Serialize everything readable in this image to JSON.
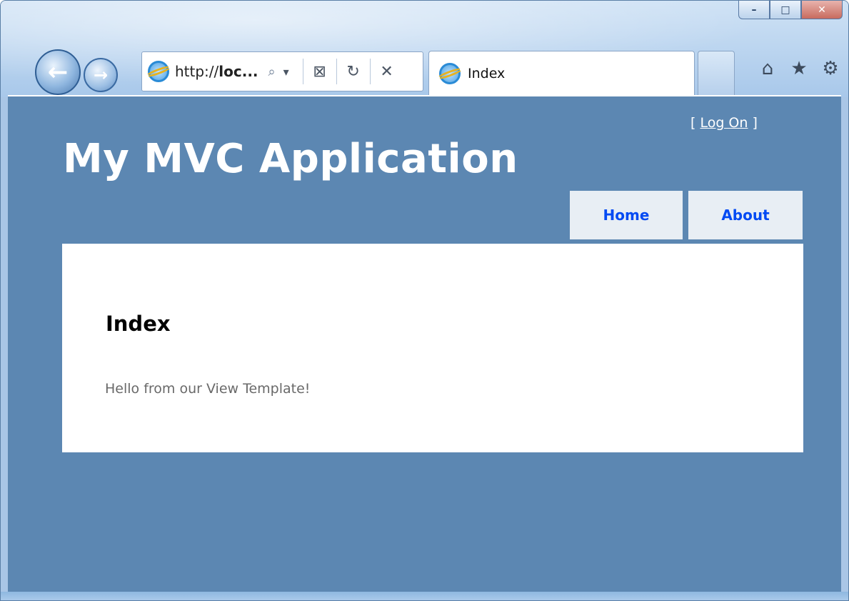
{
  "browser": {
    "address": {
      "scheme": "http://",
      "host_partial": "loc..."
    },
    "tab": {
      "title": "Index"
    },
    "caption": {
      "minimize": "–",
      "maximize": "□",
      "close": "✕"
    },
    "nav": {
      "back": "←",
      "forward": "→"
    },
    "address_buttons": {
      "search": "⌕",
      "dropdown": "▾",
      "compat": "⊠",
      "refresh": "↻",
      "stop": "✕"
    },
    "toolbar": {
      "home": "⌂",
      "favorites": "★",
      "tools": "⚙"
    }
  },
  "site": {
    "login": {
      "bracket_open": "[ ",
      "link_label": "Log On",
      "bracket_close": " ]"
    },
    "title": "My MVC Application",
    "menu": [
      {
        "label": "Home"
      },
      {
        "label": "About"
      }
    ]
  },
  "page": {
    "heading": "Index",
    "body": "Hello from our View Template!"
  },
  "colors": {
    "page_background": "#5c87b2",
    "menu_link": "#034af3",
    "menu_background": "#e8eef4",
    "body_text": "#696969"
  }
}
